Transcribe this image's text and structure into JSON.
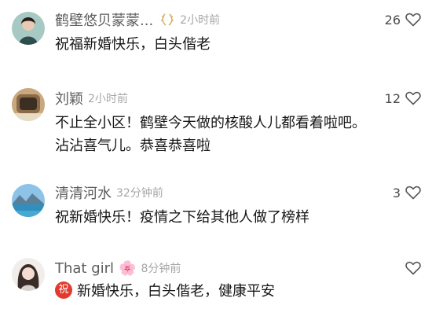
{
  "comments": [
    {
      "author": "鹤壁悠贝蒙蒙...",
      "badge_icon": "laurel-badge-icon",
      "time": "2小时前",
      "likes": "26",
      "lines": [
        "祝福新婚快乐，白头偕老"
      ]
    },
    {
      "author": "刘颖",
      "time": "2小时前",
      "likes": "12",
      "lines": [
        "不止全小区！鹤壁今天做的核酸人儿都看着啦吧。",
        "沾沾喜气儿。恭喜恭喜啦"
      ]
    },
    {
      "author": "清清河水",
      "time": "32分钟前",
      "likes": "3",
      "lines": [
        "祝新婚快乐！疫情之下给其他人做了榜样"
      ]
    },
    {
      "author": "That girl",
      "author_emoji": "🌸",
      "time": "8分钟前",
      "likes": "",
      "emoji_text": "祝",
      "lines": [
        "新婚快乐，白头偕老，健康平安"
      ]
    }
  ],
  "colors": {
    "name": "#5d5d5d",
    "time": "#a6a6a6",
    "body": "#161616",
    "emoji_red": "#e23b2e",
    "badge_gold": "#d7b06a"
  }
}
